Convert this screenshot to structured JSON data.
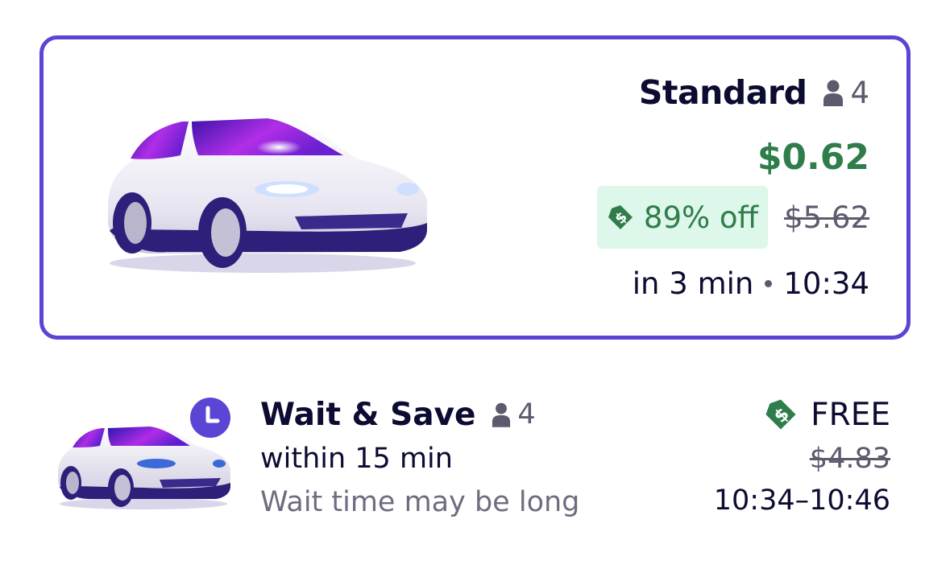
{
  "standard": {
    "title": "Standard",
    "seats": "4",
    "price": "$0.62",
    "discount": "89% off",
    "original_price": "$5.62",
    "eta": "in 3 min",
    "arrival": "10:34",
    "selected": true,
    "accent_color": "#5a45d4"
  },
  "wait_save": {
    "title": "Wait & Save",
    "seats": "4",
    "window": "within 15 min",
    "note": "Wait time may be long",
    "price": "FREE",
    "original_price": "$4.83",
    "arrival_window": "10:34–10:46",
    "badge_icon": "clock-icon"
  },
  "icons": {
    "seat": "person-icon",
    "discount": "price-tag-icon"
  },
  "colors": {
    "price_green": "#2f7d4a",
    "discount_bg": "#ddf7ea",
    "text_dark": "#0c0b31",
    "text_muted": "#5c5b6e"
  }
}
